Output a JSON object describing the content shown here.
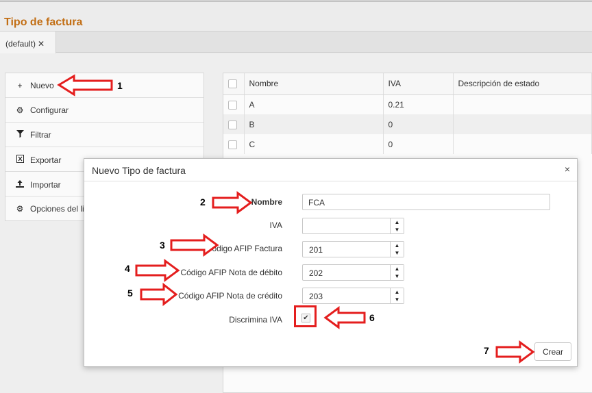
{
  "page": {
    "title": "Tipo de factura"
  },
  "tabs": [
    {
      "label": "(default)",
      "close": "✕"
    }
  ],
  "sidebar": {
    "items": [
      {
        "label": "Nuevo",
        "icon": "plus-icon"
      },
      {
        "label": "Configurar",
        "icon": "gear-icon"
      },
      {
        "label": "Filtrar",
        "icon": "filter-icon"
      },
      {
        "label": "Exportar",
        "icon": "excel-icon"
      },
      {
        "label": "Importar",
        "icon": "upload-icon"
      },
      {
        "label": "Opciones del li",
        "icon": "gear-icon"
      }
    ]
  },
  "grid": {
    "columns": [
      "Nombre",
      "IVA",
      "Descripción de estado"
    ],
    "rows": [
      {
        "nombre": "A",
        "iva": "0.21",
        "estado": ""
      },
      {
        "nombre": "B",
        "iva": "0",
        "estado": ""
      },
      {
        "nombre": "C",
        "iva": "0",
        "estado": ""
      }
    ]
  },
  "modal": {
    "title": "Nuevo Tipo de factura",
    "close": "×",
    "fields": {
      "nombre": {
        "label": "Nombre",
        "value": "FCA"
      },
      "iva": {
        "label": "IVA",
        "value": ""
      },
      "factura": {
        "label": "Código AFIP Factura",
        "value": "201"
      },
      "debito": {
        "label": "Código AFIP Nota de débito",
        "value": "202"
      },
      "credito": {
        "label": "Código AFIP Nota de crédito",
        "value": "203"
      },
      "discrimina": {
        "label": "Discrimina IVA",
        "checked": true
      }
    },
    "submit": "Crear"
  },
  "annotations": [
    "1",
    "2",
    "3",
    "4",
    "5",
    "6",
    "7"
  ],
  "colors": {
    "title": "#c26e14",
    "arrow": "#e41e1e"
  }
}
